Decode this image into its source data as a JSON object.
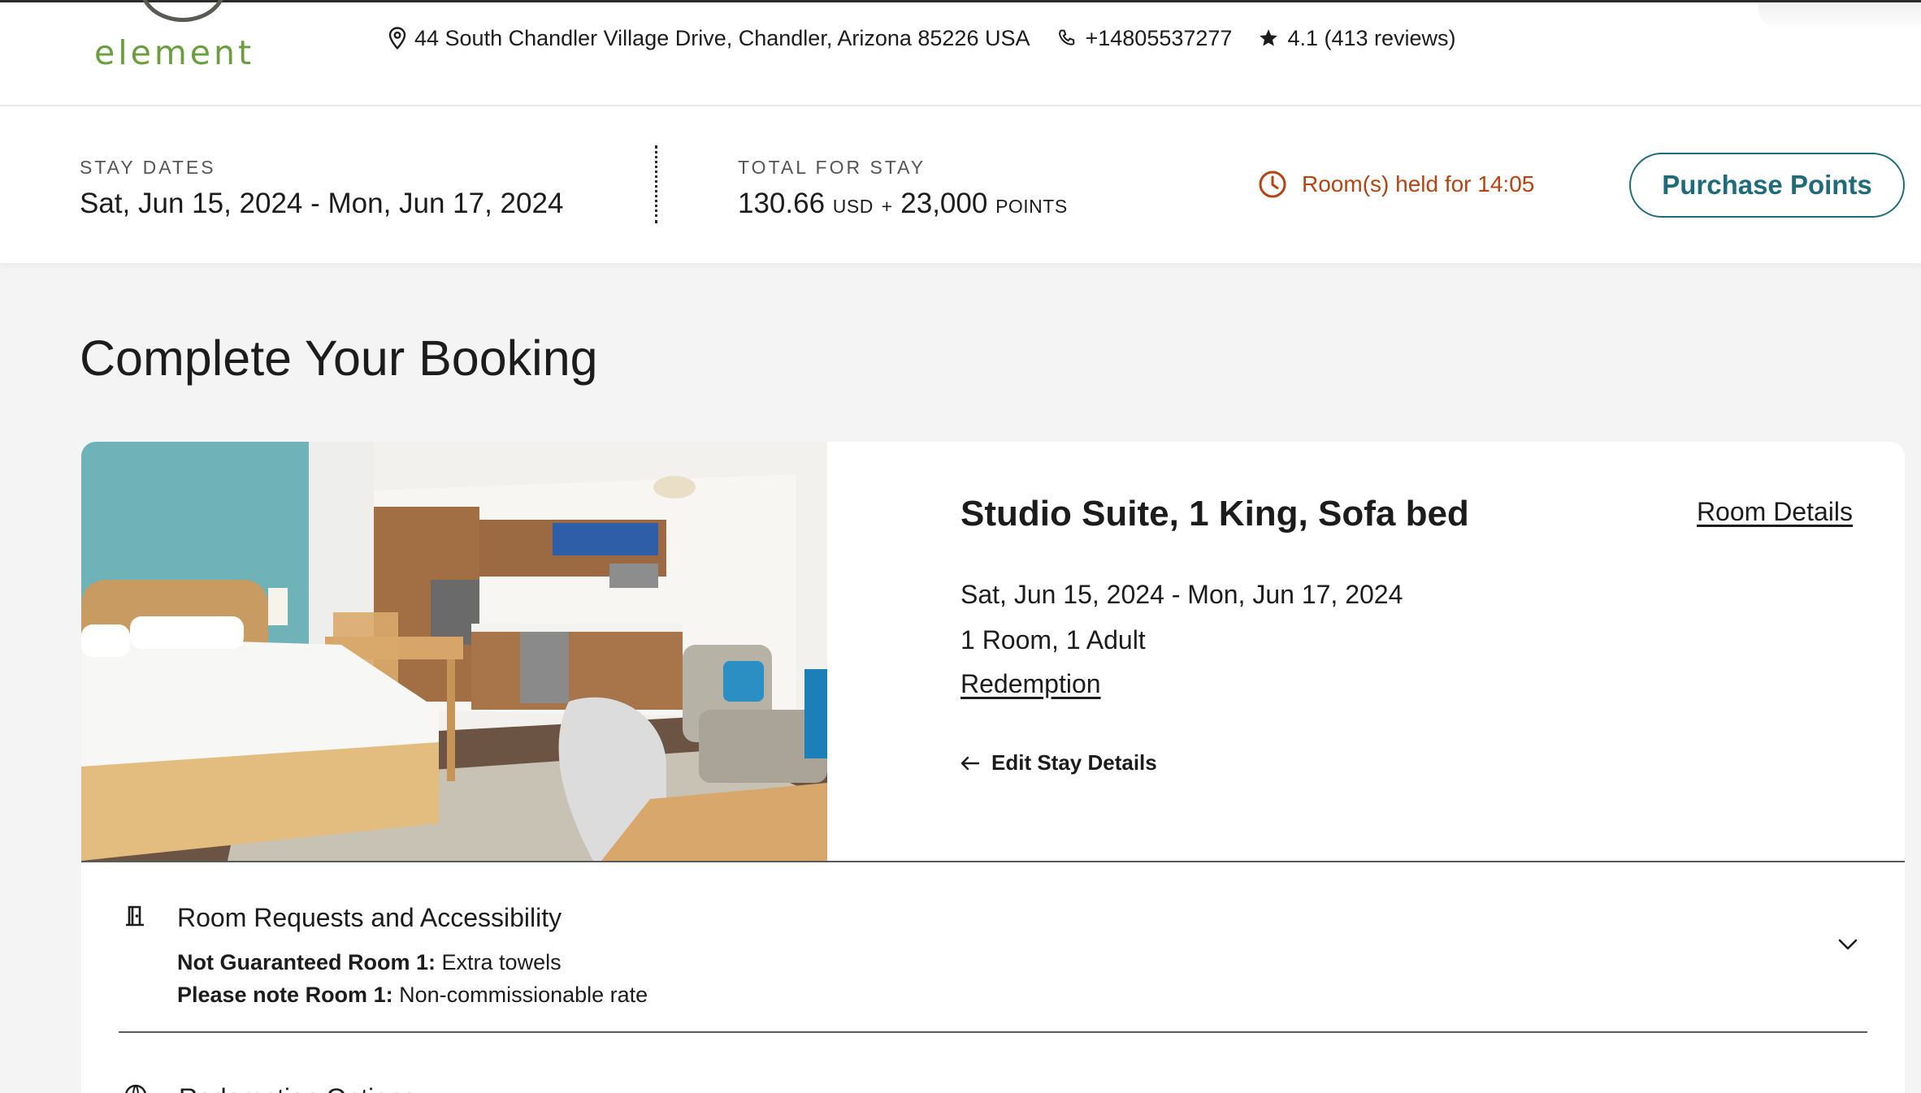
{
  "header": {
    "logo_text": "element",
    "address": "44 South Chandler Village Drive, Chandler, Arizona 85226 USA",
    "phone": "+14805537277",
    "rating": "4.1 (413 reviews)",
    "icons": [
      "location-pin-icon",
      "phone-icon",
      "star-icon"
    ]
  },
  "stay_bar": {
    "dates_label": "STAY DATES",
    "dates_value": "Sat, Jun 15, 2024 - Mon, Jun 17, 2024",
    "total_label": "TOTAL FOR STAY",
    "total_amount": "130.66",
    "total_currency": "USD",
    "plus": "+",
    "total_points": "23,000",
    "points_label": "POINTS",
    "hold_text": "Room(s) held for 14:05",
    "purchase_button": "Purchase Points"
  },
  "page": {
    "title": "Complete Your Booking"
  },
  "room": {
    "name": "Studio Suite, 1 King, Sofa bed",
    "details_link": "Room Details",
    "dates": "Sat, Jun 15, 2024 - Mon, Jun 17, 2024",
    "occupancy": "1 Room, 1 Adult",
    "rate_type": "Redemption",
    "edit_link": "Edit Stay Details"
  },
  "requests": {
    "title": "Room Requests and Accessibility",
    "items": [
      {
        "label": "Not Guaranteed Room 1:",
        "value": " Extra towels"
      },
      {
        "label": "Please note Room 1:",
        "value": " Non-commissionable rate"
      }
    ]
  },
  "next_section": {
    "title": "Redemption Options"
  },
  "colors": {
    "accent_teal": "#1f6b7a",
    "hold_orange": "#b54313",
    "logo_green": "#6a9e3e"
  }
}
